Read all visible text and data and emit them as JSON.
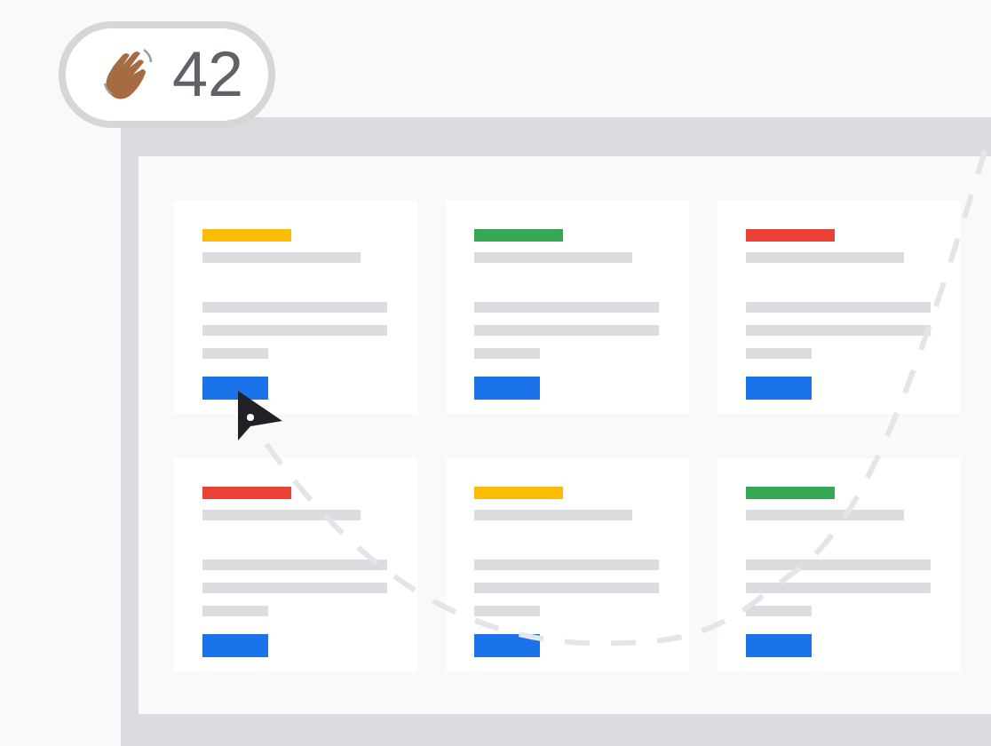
{
  "badge": {
    "count": "42"
  },
  "cards": [
    {
      "color": "#fbbc04"
    },
    {
      "color": "#34a853"
    },
    {
      "color": "#ea4335"
    },
    {
      "color": "#ea4335"
    },
    {
      "color": "#fbbc04"
    },
    {
      "color": "#34a853"
    }
  ]
}
